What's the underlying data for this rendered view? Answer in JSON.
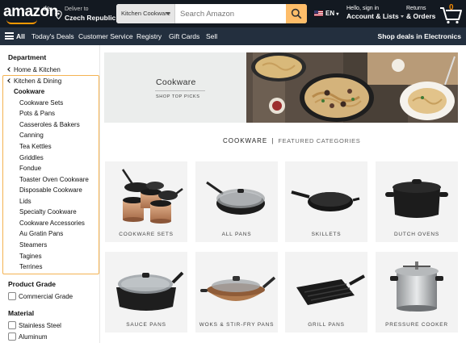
{
  "header": {
    "logo_text": "amazon",
    "logo_tld": ".de",
    "deliver_line1": "Deliver to",
    "deliver_line2": "Czech Republic",
    "search_category": "Kitchen Cookware",
    "search_placeholder": "Search Amazon",
    "language": "EN",
    "account_line1": "Hello, sign in",
    "account_line2": "Account & Lists",
    "orders_line1": "Returns",
    "orders_line2": "& Orders",
    "cart_count": "0"
  },
  "nav": {
    "all": "All",
    "items": [
      "Today's Deals",
      "Customer Service",
      "Registry",
      "Gift Cards",
      "Sell"
    ],
    "promo": "Shop deals in Electronics"
  },
  "sidebar": {
    "department_heading": "Department",
    "parent_links": [
      "Home & Kitchen",
      "Kitchen & Dining"
    ],
    "current": "Cookware",
    "subcategories": [
      "Cookware Sets",
      "Pots & Pans",
      "Casseroles & Bakers",
      "Canning",
      "Tea Kettles",
      "Griddles",
      "Fondue",
      "Toaster Oven Cookware",
      "Disposable Cookware",
      "Lids",
      "Specialty Cookware",
      "Cookware Accessories",
      "Au Gratin Pans",
      "Steamers",
      "Tagines",
      "Terrines"
    ],
    "product_grade_heading": "Product Grade",
    "product_grade_options": [
      "Commercial Grade"
    ],
    "material_heading": "Material",
    "material_options": [
      "Stainless Steel",
      "Aluminum"
    ]
  },
  "banner": {
    "title": "Cookware",
    "cta": "SHOP TOP PICKS"
  },
  "featured": {
    "left": "COOKWARE",
    "separator": "|",
    "right": "FEATURED CATEGORIES"
  },
  "tiles": [
    {
      "label": "COOKWARE SETS",
      "icon": "cookware-set-icon"
    },
    {
      "label": "ALL PANS",
      "icon": "pan-with-lid-icon"
    },
    {
      "label": "SKILLETS",
      "icon": "skillet-icon"
    },
    {
      "label": "DUTCH OVENS",
      "icon": "dutch-oven-icon"
    },
    {
      "label": "SAUCE PANS",
      "icon": "sauce-pan-icon"
    },
    {
      "label": "WOKS & STIR-FRY PANS",
      "icon": "wok-icon"
    },
    {
      "label": "GRILL PANS",
      "icon": "grill-pan-icon"
    },
    {
      "label": "PRESSURE COOKER",
      "icon": "pressure-cooker-icon"
    }
  ],
  "colors": {
    "header_bg": "#131921",
    "nav_bg": "#232f3e",
    "search_button": "#febd69",
    "highlight_border": "#f4b352",
    "cart_count": "#f08804"
  }
}
